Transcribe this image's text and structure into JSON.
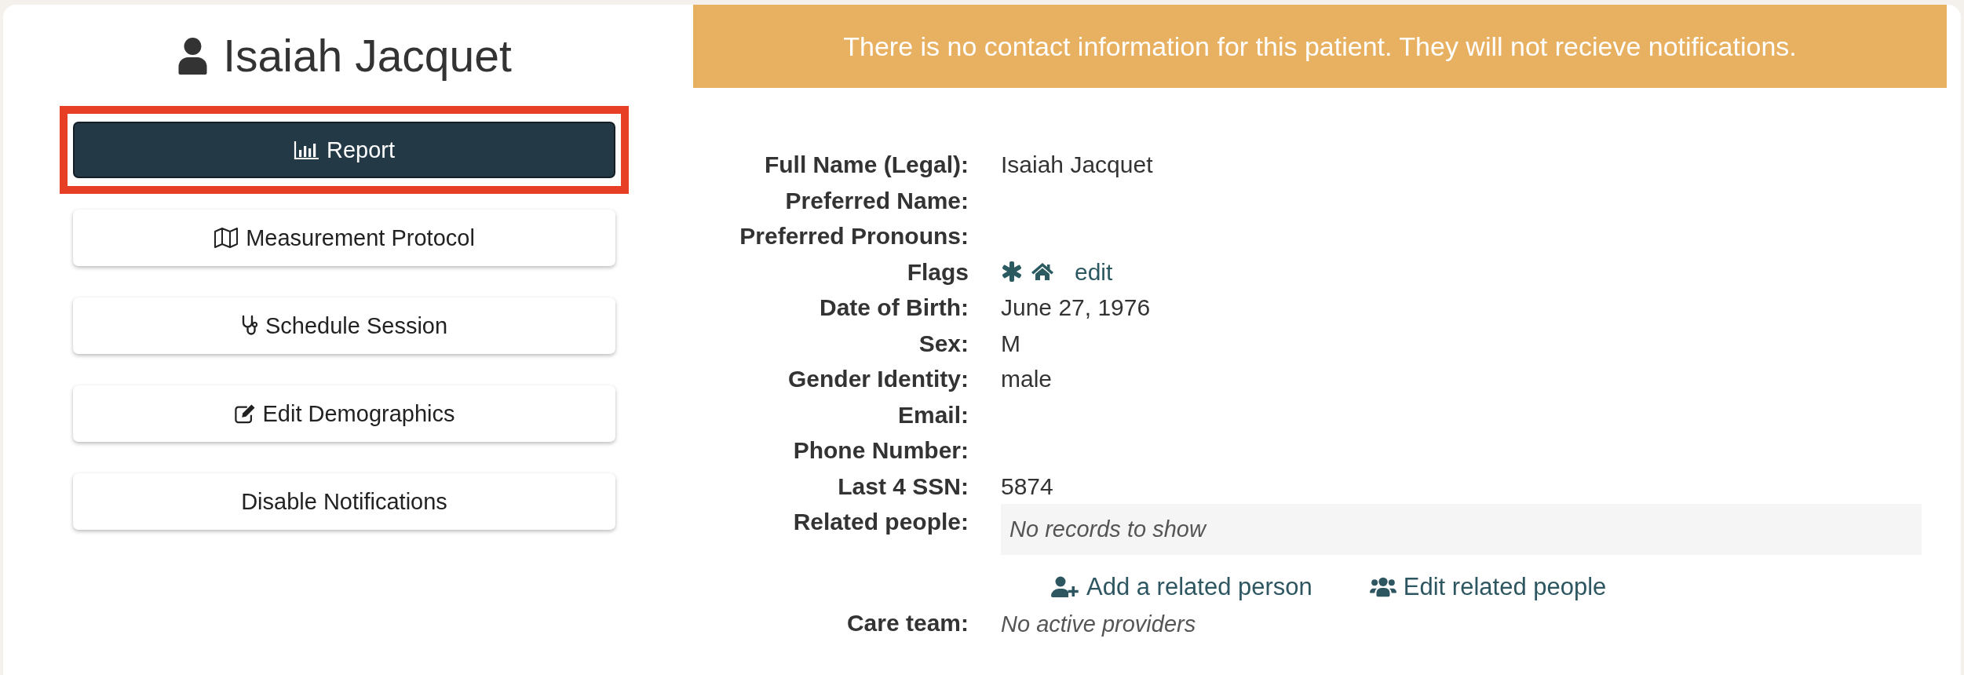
{
  "patient": {
    "name": "Isaiah Jacquet"
  },
  "actions": [
    {
      "label": "Report",
      "kind": "primary",
      "highlighted": true
    },
    {
      "label": "Measurement Protocol",
      "kind": "default",
      "highlighted": false
    },
    {
      "label": "Schedule Session",
      "kind": "default",
      "highlighted": false
    },
    {
      "label": "Edit Demographics",
      "kind": "default",
      "highlighted": false
    },
    {
      "label": "Disable Notifications",
      "kind": "default",
      "highlighted": false
    }
  ],
  "notice": {
    "text": "There is no contact information for this patient. They will not recieve notifications."
  },
  "details": [
    {
      "label": "Full Name (Legal):",
      "kind": "text",
      "value": "Isaiah Jacquet"
    },
    {
      "label": "Preferred Name:",
      "kind": "text"
    },
    {
      "label": "Preferred Pronouns:",
      "kind": "text"
    },
    {
      "label": "Flags",
      "kind": "flags",
      "link": "edit"
    },
    {
      "label": "Date of Birth:",
      "kind": "text",
      "value": "June 27, 1976"
    },
    {
      "label": "Sex:",
      "kind": "text",
      "value": "M"
    },
    {
      "label": "Gender Identity:",
      "kind": "text",
      "value": "male"
    },
    {
      "label": "Email:",
      "kind": "text"
    },
    {
      "label": "Phone Number:",
      "kind": "text"
    },
    {
      "label": "Last 4 SSN:",
      "kind": "text",
      "value": "5874"
    }
  ],
  "related_people": {
    "label": "Related people:",
    "empty_text": "No records to show",
    "links": [
      "Add a related person",
      "Edit related people"
    ]
  },
  "care_team": {
    "label": "Care team:",
    "value": "No active providers"
  }
}
